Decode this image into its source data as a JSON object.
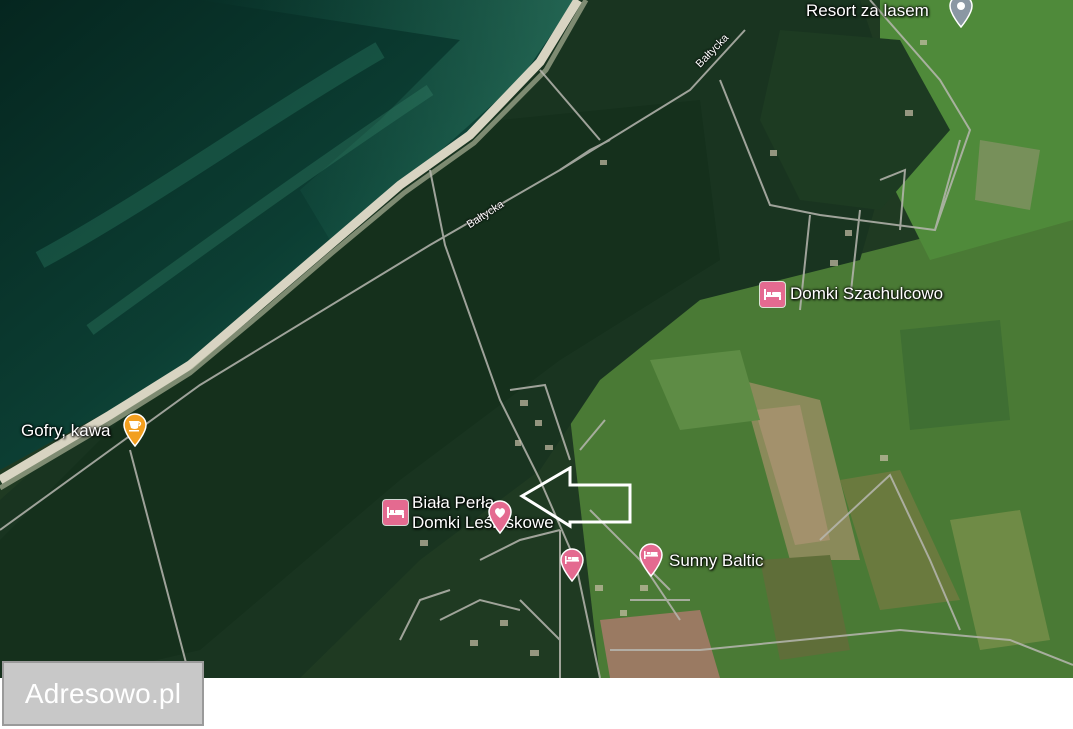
{
  "map": {
    "type": "satellite",
    "places": {
      "resort": "Resort za lasem",
      "szachulcowo": "Domki Szachulcowo",
      "gofry": "Gofry, kawa",
      "biala_perla_line1": "Biała Perła",
      "biala_perla_line2": "Domki Leśniskowe",
      "sunny_baltic": "Sunny Baltic"
    },
    "roads": {
      "baltycka_upper": "Bałtycka",
      "baltycka_lower": "Bałtycka"
    },
    "colors": {
      "lodging": "#e46a90",
      "cafe": "#f29f1f",
      "generic_pin": "#8a97a3"
    },
    "icons": [
      "lodging-icon",
      "cafe-icon",
      "heart-pin-icon",
      "lodging-pin-icon",
      "generic-pin-icon",
      "arrow-icon"
    ]
  },
  "watermark": "Adresowo.pl"
}
